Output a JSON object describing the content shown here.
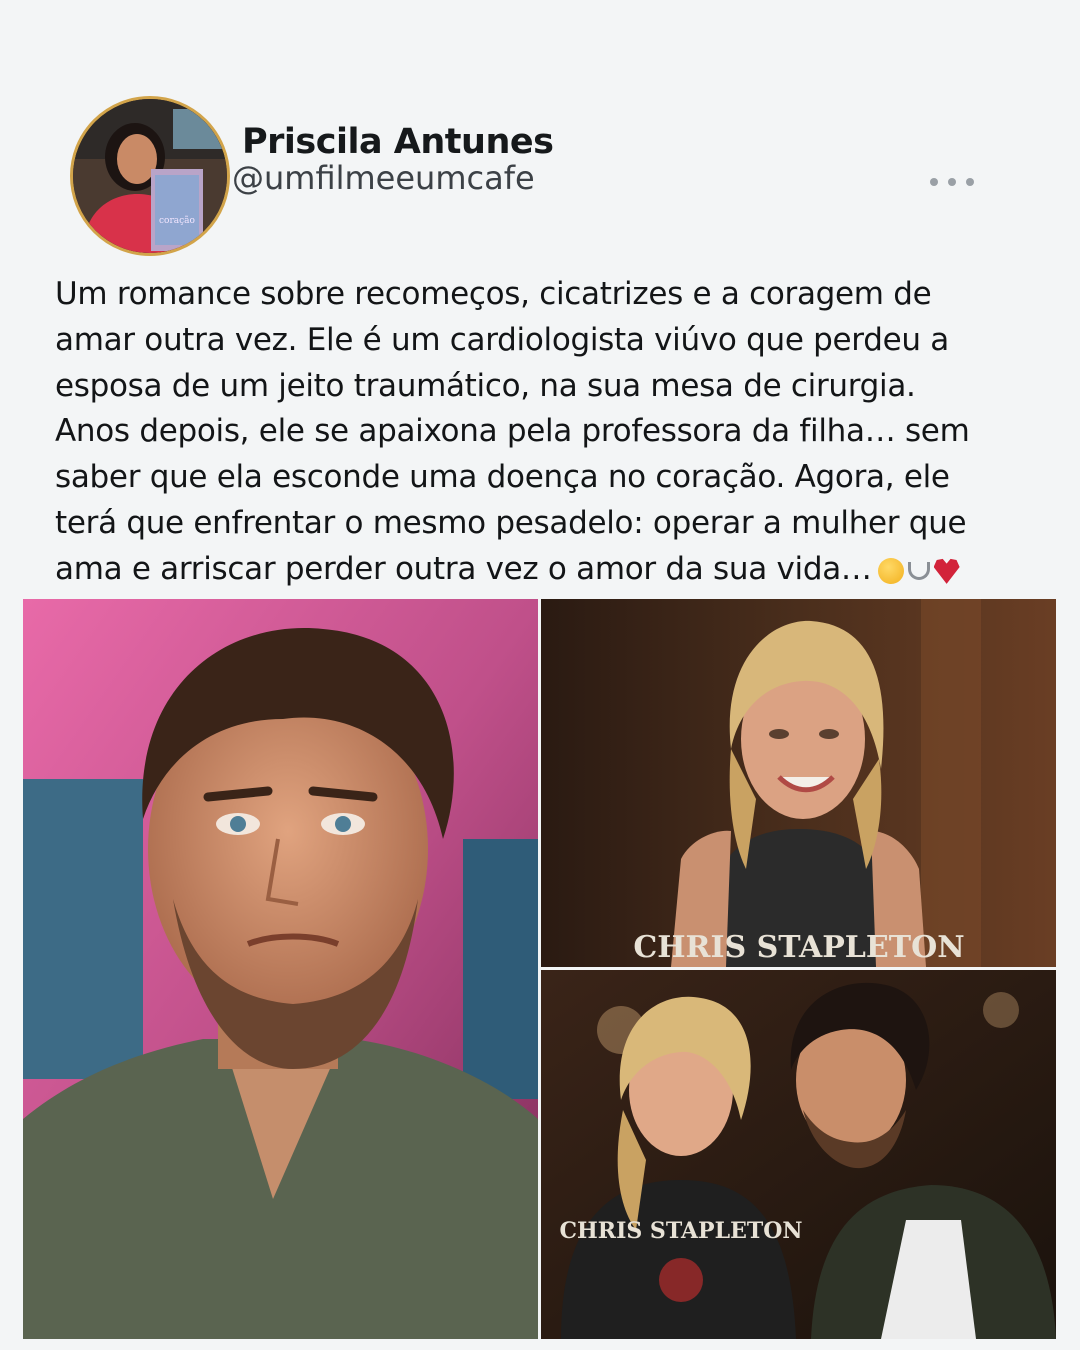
{
  "post": {
    "author_name": "Priscila Antunes",
    "author_handle": "@umfilmeeumcafe",
    "avatar_icon": "profile-photo-with-book",
    "more_icon": "more-horizontal-icon",
    "text": "Um romance sobre recomeços, cicatrizes e a coragem de\namar outra vez. Ele é um cardiologista viúvo que perdeu a\nesposa de um jeito traumático, na sua mesa de cirurgia.\nAnos depois, ele se apaixona pela professora da filha… sem\nsaber que ela esconde uma doença no coração. Agora, ele\nterá que enfrentar o mesmo pesadelo: operar a mulher que\nama e arriscar perder outra vez o amor da sua vida…",
    "emojis": [
      "pleading-face",
      "stethoscope",
      "broken-heart"
    ]
  },
  "photos": {
    "left": {
      "shirt_text": ""
    },
    "top_right": {
      "shirt_text": "CHRIS STAPLETON"
    },
    "bottom_right": {
      "shirt_text": "CHRIS STAPLETON"
    }
  },
  "colors": {
    "background": "#f3f5f6",
    "avatar_ring": "#d2a44a",
    "text": "#131517"
  }
}
